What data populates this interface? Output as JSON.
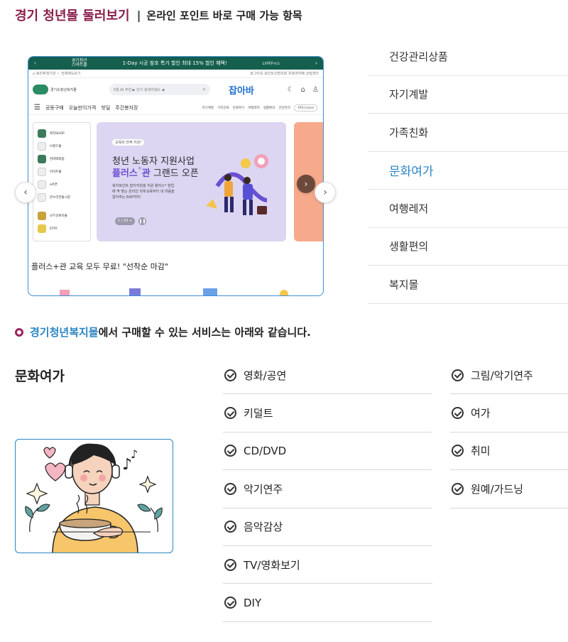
{
  "header": {
    "title": "경기 청년몰 둘러보기",
    "separator": "|",
    "subtitle": "온라인 포인트 바로 구매 가능 항목"
  },
  "screenshot": {
    "topbar_logo": "경기청년\n스마트몰",
    "topbar_promo": "1-Day 시공 참호 특가 할인  최대 15% 할인 혜택!",
    "topbar_partner": "LX하우시스",
    "linkbar_left": "⌂ 복리후생기관  ☆ 전체제도보기",
    "linkbar_right": "로그아웃  포인트간편조회  위로마하퀘  상담센터",
    "site_logo_text": "경기도청년복지몰",
    "search_placeholder": "5월 AI 추천 ▶ 인기 검색키워드 ◀",
    "brand": "잡아바",
    "nav": [
      "공동구매",
      "오늘만이가격",
      "핫딜",
      "주간봉자장"
    ],
    "nav_right": [
      "자기계발",
      "가족친화",
      "문화여가",
      "여행레저",
      "생활편의",
      "건강관리"
    ],
    "nav_zone": "서비스zone",
    "categories": [
      "복지SHOP",
      "브랜드몰",
      "현대백화점",
      "이마트몰",
      "e쿠폰",
      "문누리전통시장",
      "모두의복지몰",
      "E마트"
    ],
    "banner_tag": "교육비 전액 지원!",
    "banner_line1": "청년 노동자 지원사업",
    "banner_line2_bold": "플러스",
    "banner_line2_bold2": "관",
    "banner_line2_rest": " 그랜드 오픈",
    "banner_desc": "복지포인트 잡아지원을 지원 플러스* 현업에 딱 맞는 온라인 직무교육부터 내 마음을 알아주는 EAP까지!",
    "pager": "1 / 10 +",
    "caption": "플러스+관 교육 모두 무료! \"선착순 마감\""
  },
  "category_menu": {
    "items": [
      "건강관리상품",
      "자기계발",
      "가족친화",
      "문화여가",
      "여행레저",
      "생활편의",
      "복지몰"
    ],
    "active": "문화여가"
  },
  "intro": {
    "highlight": "경기청년복지몰",
    "rest": "에서 구매할 수 있는 서비스는 아래와 같습니다."
  },
  "section_title": "문화여가",
  "services_col1": [
    "영화/공연",
    "키덜트",
    "CD/DVD",
    "악기연주",
    "음악감상",
    "TV/영화보기",
    "DIY"
  ],
  "services_col2": [
    "그림/악기연주",
    "여가",
    "취미",
    "원예/가드닝"
  ],
  "colors": {
    "title": "#8a1f4d",
    "accent_blue": "#2a85c4",
    "bullet": "#9a2461"
  }
}
